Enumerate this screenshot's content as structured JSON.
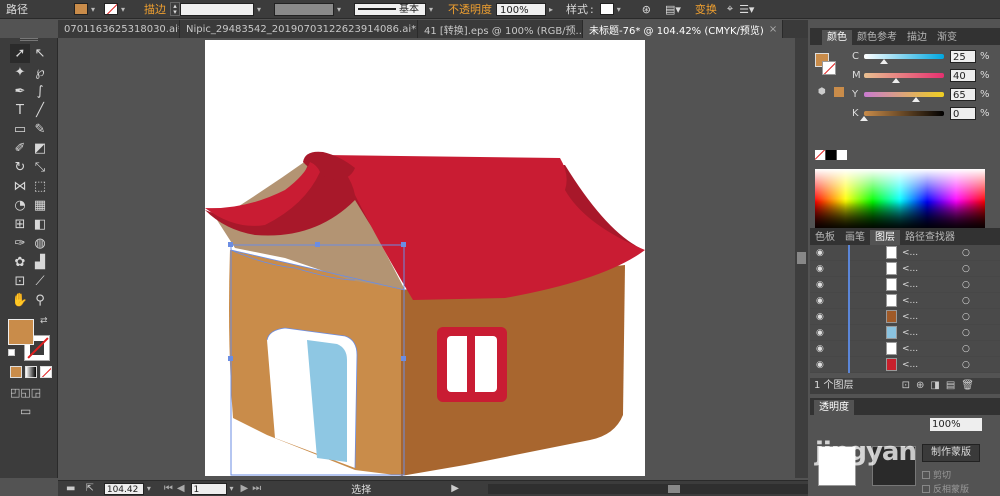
{
  "control_bar": {
    "object_type": "路径",
    "stroke_label": "描边",
    "brush_label": "基本",
    "opacity_label": "不透明度",
    "opacity_value": "100%",
    "style_label": "样式",
    "transform_link": "变换",
    "fill_color": "#c98c4a"
  },
  "tabs": [
    {
      "label": "0701163625318030.ai*",
      "active": false
    },
    {
      "label": "Nipic_29483542_20190703122623914086.ai*",
      "active": false
    },
    {
      "label": "41 [转换].eps @ 100% (RGB/预...",
      "active": false
    },
    {
      "label": "未标题-76* @ 104.42% (CMYK/预览)",
      "active": true
    }
  ],
  "tool_icons": [
    "selection-tool-icon",
    "direct-selection-tool-icon",
    "magic-wand-tool-icon",
    "lasso-tool-icon",
    "pen-tool-icon",
    "curvature-tool-icon",
    "type-tool-icon",
    "line-tool-icon",
    "rectangle-tool-icon",
    "paintbrush-tool-icon",
    "pencil-tool-icon",
    "eraser-tool-icon",
    "rotate-tool-icon",
    "scale-tool-icon",
    "width-tool-icon",
    "free-transform-tool-icon",
    "shape-builder-tool-icon",
    "perspective-grid-tool-icon",
    "mesh-tool-icon",
    "gradient-tool-icon",
    "eyedropper-tool-icon",
    "blend-tool-icon",
    "symbol-sprayer-tool-icon",
    "column-graph-tool-icon",
    "artboard-tool-icon",
    "slice-tool-icon",
    "hand-tool-icon",
    "zoom-tool-icon"
  ],
  "color_panel": {
    "tabs": [
      "颜色",
      "颜色参考",
      "描边",
      "渐变"
    ],
    "channels": [
      {
        "name": "C",
        "value": "25",
        "fraction": 0.25,
        "gradient": "linear-gradient(to right,#fff,#00a7e0)"
      },
      {
        "name": "M",
        "value": "40",
        "fraction": 0.4,
        "gradient": "linear-gradient(to right,#e8c090,#e63070)"
      },
      {
        "name": "Y",
        "value": "65",
        "fraction": 0.65,
        "gradient": "linear-gradient(to right,#c87ad0,#f0d020)"
      },
      {
        "name": "K",
        "value": "0",
        "fraction": 0.0,
        "gradient": "linear-gradient(to right,#c98c4a,#000)"
      }
    ],
    "percent": "%"
  },
  "layers_panel": {
    "tabs": [
      "色板",
      "画笔",
      "图层",
      "路径查找器"
    ],
    "rows": [
      {
        "name": "<...",
        "thumb": "#ffffff"
      },
      {
        "name": "<...",
        "thumb": "#ffffff"
      },
      {
        "name": "<...",
        "thumb": "#ffffff"
      },
      {
        "name": "<...",
        "thumb": "#ffffff"
      },
      {
        "name": "<...",
        "thumb": "#a05a28"
      },
      {
        "name": "<...",
        "thumb": "#8ac3e0"
      },
      {
        "name": "<...",
        "thumb": "#ffffff"
      },
      {
        "name": "<...",
        "thumb": "#c8202c"
      }
    ],
    "footer": "1 个图层"
  },
  "transparency_panel": {
    "title": "透明度",
    "opacity_value": "100%",
    "make_mask": "制作蒙版",
    "clip": "剪切",
    "invert_mask": "反相蒙版"
  },
  "status_bar": {
    "zoom": "104.42",
    "page": "1",
    "tool_label": "选择"
  },
  "watermark": "jingyan"
}
